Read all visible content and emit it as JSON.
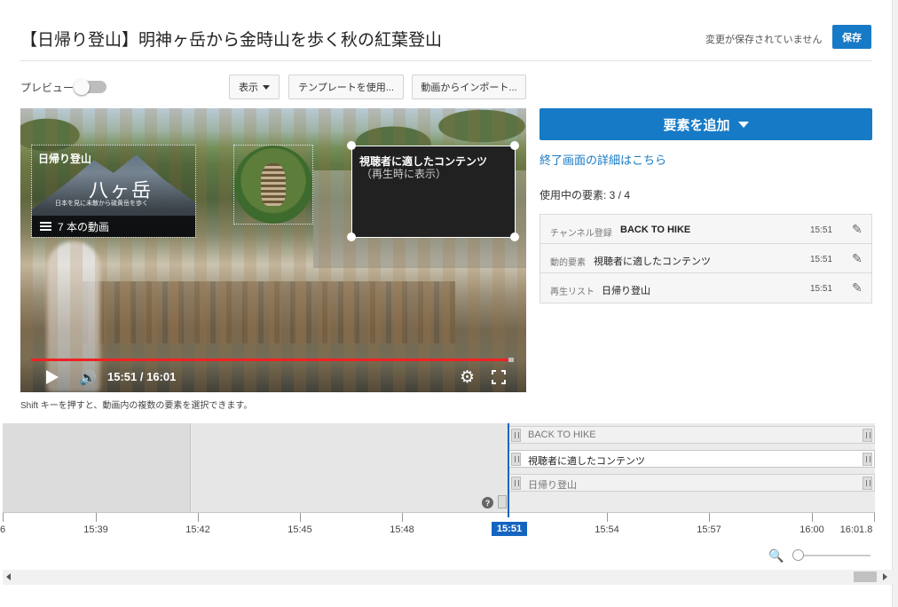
{
  "header": {
    "title": "【日帰り登山】明神ヶ岳から金時山を歩く秋の紅葉登山",
    "status": "変更が保存されていません",
    "save_label": "保存"
  },
  "toolbar": {
    "preview_label": "プレビュー",
    "preview_enabled": false,
    "show_label": "表示",
    "template_label": "テンプレートを使用...",
    "import_label": "動画からインポート..."
  },
  "video": {
    "playlist": {
      "title": "日帰り登山",
      "art_title": "八ヶ岳",
      "art_subtitle": "日本を見に未散から硫黄岳を歩く",
      "count_label": "7 本の動画"
    },
    "content_element": {
      "title": "視聴者に適したコンテンツ",
      "subtitle": "（再生時に表示）"
    },
    "time": "15:51 / 16:01",
    "progress": 0.99
  },
  "hint": "Shift キーを押すと、動画内の複数の要素を選択できます。",
  "panel": {
    "add_label": "要素を追加",
    "detail_link": "終了画面の詳細はこちら",
    "usage": "使用中の要素: 3 / 4",
    "elements": [
      {
        "kind": "チャンネル登録",
        "name": "BACK TO HIKE",
        "time": "15:51"
      },
      {
        "kind": "動的要素",
        "name": "視聴者に適したコンテンツ",
        "time": "15:51"
      },
      {
        "kind": "再生リスト",
        "name": "日帰り登山",
        "time": "15:51"
      }
    ]
  },
  "timeline": {
    "tracks": [
      "BACK TO HIKE",
      "視聴者に適したコンテンツ",
      "日帰り登山"
    ],
    "ticks": [
      "6",
      "15:39",
      "15:42",
      "15:45",
      "15:48",
      "15:54",
      "15:57",
      "16:00",
      "16:01.8"
    ],
    "current": "15:51"
  },
  "colors": {
    "accent": "#167ac6",
    "playhead": "#1565c0",
    "progress": "#e22222"
  }
}
